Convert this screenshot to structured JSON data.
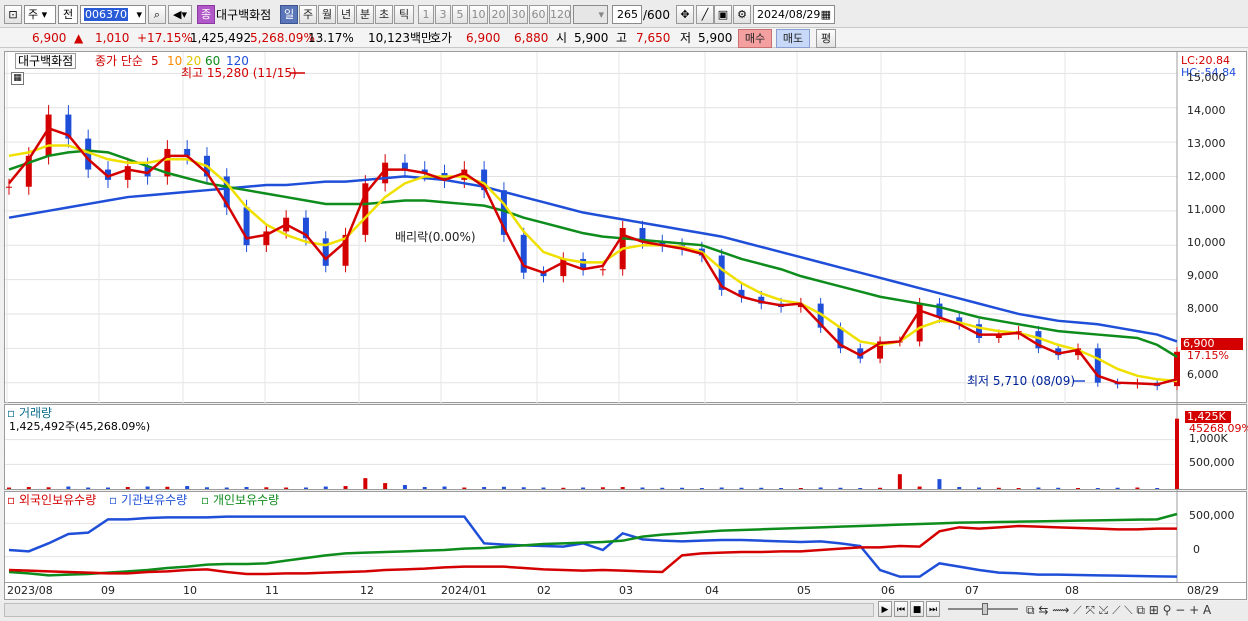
{
  "toolbar": {
    "period_short": "주",
    "prev_label": "전",
    "code": "006370",
    "name_badge": "종",
    "name": "대구백화점",
    "periods": [
      "일",
      "주",
      "월",
      "년",
      "분",
      "초",
      "틱"
    ],
    "intervals": [
      "1",
      "3",
      "5",
      "10",
      "20",
      "30",
      "60",
      "120"
    ],
    "count": "265",
    "count_total": "/600",
    "date": "2024/08/29"
  },
  "info": {
    "price": "6,900",
    "up_icon": "▲",
    "change": "1,010",
    "change_pct": "+17.15%",
    "volume": "1,425,492",
    "volume_pct": "5,268.09%",
    "turnover": "13.17%",
    "amount": "10,123백만",
    "ask_label": "호가",
    "ask1": "6,900",
    "ask2": "6,880",
    "open_label": "시",
    "open": "5,900",
    "high_label": "고",
    "high": "7,650",
    "low_label": "저",
    "low": "5,900",
    "buy": "매수",
    "sell": "매도",
    "avg": "평"
  },
  "main": {
    "title": "대구백화점",
    "ma_title": "종가 단순",
    "ma_periods": [
      "5",
      "10",
      "20",
      "60",
      "120"
    ],
    "ma_colors": [
      "#d40000",
      "#ff8a00",
      "#f0e000",
      "#0e8c1c",
      "#1f4fd8"
    ],
    "high_note": "최고 15,280 (11/15)",
    "low_note": "최저 5,710 (08/09)",
    "center_note": "배리락(0.00%)",
    "lc": "LC:20.84",
    "hc": "HC:-54.84",
    "price_tag": "6,900",
    "pct_tag": "17.15%",
    "yticks": [
      "15,000",
      "14,000",
      "13,000",
      "12,000",
      "11,000",
      "10,000",
      "9,000",
      "8,000",
      "7,000",
      "6,000"
    ]
  },
  "volume": {
    "title": "거래량",
    "subtitle": "1,425,492주(45,268.09%)",
    "tag": "1,425K",
    "tag_pct": "45268.09%",
    "yticks": [
      "1,000K",
      "500,000"
    ]
  },
  "holding": {
    "titles": [
      "외국인보유수량",
      "기관보유수량",
      "개인보유수량"
    ],
    "colors": [
      "#d40000",
      "#1f4fd8",
      "#0e8c1c"
    ],
    "yticks": [
      "500,000",
      "0"
    ]
  },
  "xaxis": {
    "labels": [
      "2023/08",
      "09",
      "10",
      "11",
      "12",
      "2024/01",
      "02",
      "03",
      "04",
      "05",
      "06",
      "07",
      "08",
      "08/29"
    ]
  },
  "chart_data": {
    "type": "line",
    "title": "대구백화점",
    "ylim": [
      5700,
      15300
    ],
    "price_close": [
      11700,
      12600,
      13800,
      13100,
      12200,
      11900,
      12300,
      12000,
      12800,
      12600,
      12000,
      11100,
      10000,
      10400,
      10800,
      10200,
      9400,
      10300,
      11800,
      12400,
      12200,
      12100,
      11900,
      12200,
      11600,
      10300,
      9200,
      9100,
      9600,
      9300,
      9300,
      10500,
      10100,
      10000,
      9900,
      9700,
      8700,
      8500,
      8300,
      8200,
      8300,
      7600,
      7000,
      6700,
      7200,
      7200,
      8300,
      7900,
      7700,
      7300,
      7400,
      7500,
      7000,
      6800,
      7000,
      6000,
      5950,
      6000,
      5900,
      6900
    ],
    "ma5": [
      11800,
      12500,
      13400,
      13200,
      12500,
      12000,
      12200,
      12100,
      12600,
      12600,
      12100,
      11200,
      10200,
      10300,
      10600,
      10300,
      9600,
      10100,
      11500,
      12200,
      12200,
      12100,
      11900,
      12100,
      11700,
      10500,
      9400,
      9200,
      9500,
      9300,
      9400,
      10300,
      10100,
      10000,
      9900,
      9750,
      8800,
      8500,
      8350,
      8250,
      8300,
      7700,
      7100,
      6800,
      7150,
      7200,
      8100,
      7900,
      7700,
      7400,
      7400,
      7450,
      7100,
      6850,
      6950,
      6200,
      6000,
      5980,
      5950,
      6100
    ],
    "ma20": [
      12600,
      12700,
      12900,
      12900,
      12700,
      12500,
      12400,
      12400,
      12500,
      12500,
      12300,
      11800,
      11100,
      10600,
      10300,
      10100,
      10000,
      10200,
      10800,
      11400,
      11800,
      12000,
      12000,
      12000,
      11800,
      11200,
      10400,
      9800,
      9600,
      9500,
      9500,
      9900,
      10000,
      10000,
      9950,
      9800,
      9300,
      8900,
      8600,
      8400,
      8300,
      8000,
      7600,
      7200,
      7100,
      7200,
      7600,
      7800,
      7750,
      7600,
      7500,
      7450,
      7300,
      7100,
      6950,
      6700,
      6400,
      6200,
      6100,
      6050
    ],
    "ma60": [
      12200,
      12400,
      12600,
      12700,
      12750,
      12700,
      12500,
      12300,
      12100,
      11950,
      11800,
      11700,
      11600,
      11500,
      11400,
      11300,
      11200,
      11200,
      11200,
      11250,
      11300,
      11300,
      11250,
      11200,
      11150,
      11000,
      10800,
      10650,
      10500,
      10350,
      10250,
      10200,
      10150,
      10100,
      10050,
      10000,
      9800,
      9600,
      9450,
      9300,
      9100,
      8950,
      8800,
      8650,
      8500,
      8400,
      8300,
      8200,
      8050,
      7900,
      7800,
      7700,
      7600,
      7500,
      7450,
      7400,
      7350,
      7300,
      7100,
      6750
    ],
    "ma120": [
      10800,
      10900,
      11000,
      11100,
      11200,
      11300,
      11400,
      11450,
      11500,
      11550,
      11600,
      11650,
      11700,
      11750,
      11750,
      11800,
      11850,
      11850,
      11900,
      11950,
      12000,
      11950,
      11900,
      11800,
      11700,
      11550,
      11400,
      11250,
      11100,
      10950,
      10850,
      10750,
      10650,
      10550,
      10450,
      10350,
      10250,
      10100,
      9950,
      9800,
      9650,
      9500,
      9350,
      9200,
      9050,
      8900,
      8750,
      8600,
      8450,
      8300,
      8150,
      8000,
      7900,
      7800,
      7750,
      7700,
      7600,
      7500,
      7400,
      7200
    ],
    "volume": [
      30000,
      40000,
      35000,
      50000,
      30000,
      30000,
      40000,
      50000,
      45000,
      60000,
      35000,
      30000,
      40000,
      35000,
      30000,
      30000,
      50000,
      60000,
      220000,
      120000,
      80000,
      40000,
      50000,
      30000,
      40000,
      45000,
      35000,
      30000,
      25000,
      30000,
      35000,
      40000,
      30000,
      25000,
      25000,
      20000,
      30000,
      25000,
      25000,
      20000,
      20000,
      30000,
      25000,
      20000,
      25000,
      300000,
      50000,
      200000,
      40000,
      30000,
      25000,
      20000,
      30000,
      25000,
      20000,
      20000,
      25000,
      30000,
      20000,
      1425492
    ],
    "foreign_holding": [
      -200000,
      -210000,
      -220000,
      -230000,
      -240000,
      -250000,
      -250000,
      -230000,
      -220000,
      -200000,
      -190000,
      -230000,
      -260000,
      -260000,
      -250000,
      -250000,
      -240000,
      -230000,
      -220000,
      -200000,
      -190000,
      -180000,
      -160000,
      -150000,
      -150000,
      -150000,
      -170000,
      -190000,
      -200000,
      -210000,
      -200000,
      -210000,
      -220000,
      -230000,
      20000,
      50000,
      60000,
      70000,
      70000,
      80000,
      80000,
      100000,
      120000,
      140000,
      140000,
      160000,
      150000,
      380000,
      440000,
      420000,
      440000,
      460000,
      450000,
      440000,
      430000,
      420000,
      410000,
      410000,
      420000,
      420000
    ],
    "institution_holding": [
      100000,
      80000,
      200000,
      340000,
      360000,
      560000,
      560000,
      580000,
      590000,
      590000,
      590000,
      600000,
      600000,
      600000,
      600000,
      600000,
      600000,
      600000,
      600000,
      600000,
      600000,
      600000,
      600000,
      600000,
      200000,
      180000,
      170000,
      160000,
      150000,
      200000,
      100000,
      350000,
      260000,
      240000,
      230000,
      240000,
      250000,
      250000,
      240000,
      230000,
      220000,
      230000,
      200000,
      160000,
      -200000,
      -300000,
      -300000,
      -100000,
      -150000,
      -200000,
      -240000,
      -250000,
      -270000,
      -270000,
      -275000,
      -280000,
      -285000,
      -290000,
      -295000,
      -300000
    ],
    "individual_holding": [
      -230000,
      -250000,
      -280000,
      -270000,
      -260000,
      -240000,
      -220000,
      -200000,
      -170000,
      -150000,
      -120000,
      -110000,
      -110000,
      -100000,
      -60000,
      -20000,
      20000,
      50000,
      60000,
      70000,
      80000,
      90000,
      100000,
      120000,
      130000,
      150000,
      170000,
      190000,
      200000,
      210000,
      220000,
      240000,
      300000,
      330000,
      350000,
      370000,
      390000,
      400000,
      410000,
      420000,
      430000,
      440000,
      450000,
      460000,
      470000,
      480000,
      490000,
      500000,
      510000,
      515000,
      520000,
      525000,
      530000,
      535000,
      540000,
      545000,
      550000,
      555000,
      560000,
      640000
    ]
  }
}
